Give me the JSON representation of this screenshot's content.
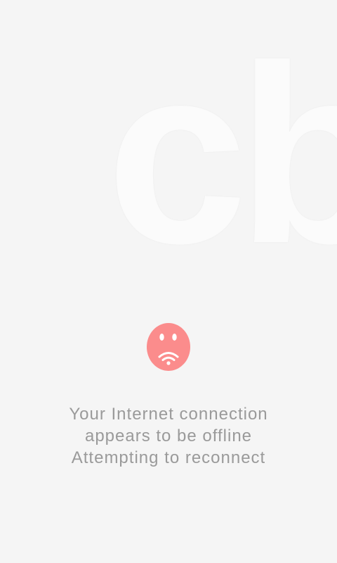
{
  "background_logo": {
    "text": "cb"
  },
  "offline_icon": {
    "name": "sad-face-wifi-icon",
    "color": "#fb8c8c"
  },
  "message": {
    "line1": "Your Internet connection",
    "line2": "appears to be offline",
    "line3": "Attempting to reconnect"
  },
  "colors": {
    "background": "#f5f5f5",
    "text": "#9a9a9a"
  }
}
